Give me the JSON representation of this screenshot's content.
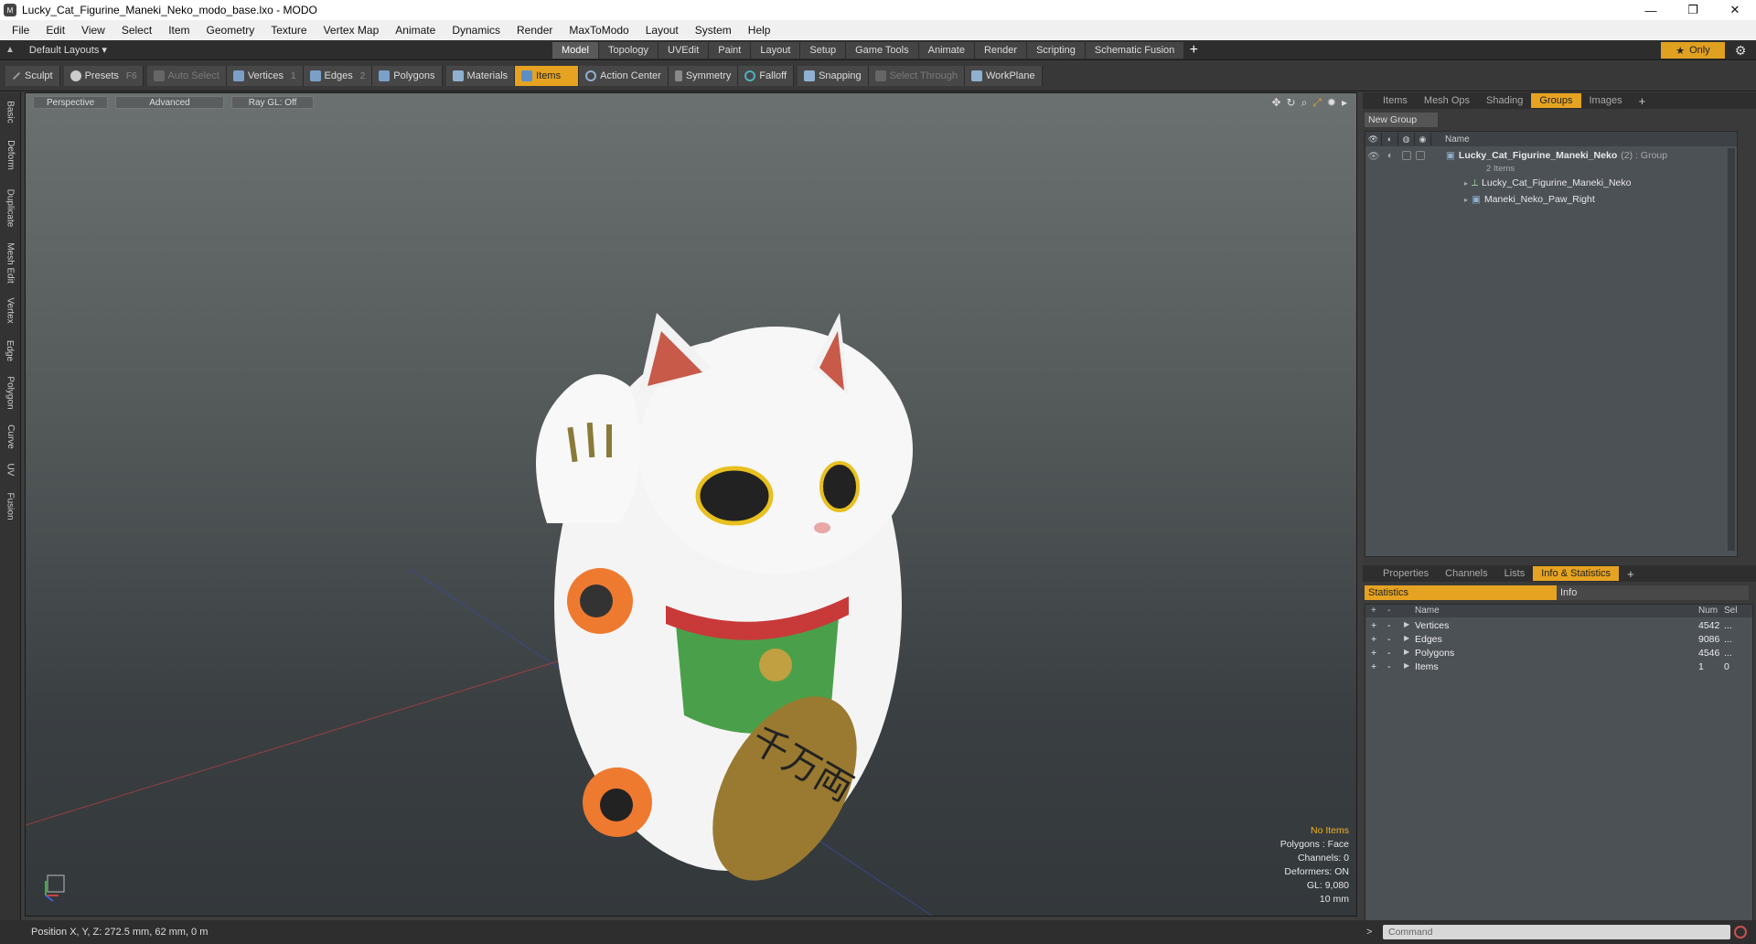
{
  "window": {
    "title": "Lucky_Cat_Figurine_Maneki_Neko_modo_base.lxo - MODO",
    "app_icon": "modo-logo",
    "buttons": {
      "minimize": "—",
      "restore": "❐",
      "close": "✕"
    }
  },
  "menu": [
    "File",
    "Edit",
    "View",
    "Select",
    "Item",
    "Geometry",
    "Texture",
    "Vertex Map",
    "Animate",
    "Dynamics",
    "Render",
    "MaxToModo",
    "Layout",
    "System",
    "Help"
  ],
  "layoutbar": {
    "layout_label": "Default Layouts",
    "tabs": [
      "Model",
      "Topology",
      "UVEdit",
      "Paint",
      "Layout",
      "Setup",
      "Game Tools",
      "Animate",
      "Render",
      "Scripting",
      "Schematic Fusion"
    ],
    "active_tab": "Model",
    "add_tab": "+",
    "only_label": "Only",
    "accent": "#e6a321"
  },
  "toolbar": {
    "sculpt": "Sculpt",
    "presets": "Presets",
    "presets_key": "F6",
    "auto_select": "Auto Select",
    "vertices": "Vertices",
    "vertices_key": "1",
    "edges": "Edges",
    "edges_key": "2",
    "polygons": "Polygons",
    "materials": "Materials",
    "items": "Items",
    "action_center": "Action Center",
    "symmetry": "Symmetry",
    "falloff": "Falloff",
    "snapping": "Snapping",
    "select_through": "Select Through",
    "workplane": "WorkPlane"
  },
  "left_tabs": [
    "Basic",
    "Deform",
    "Duplicate",
    "Mesh Edit",
    "Vertex",
    "Edge",
    "Polygon",
    "Curve",
    "UV",
    "Fusion"
  ],
  "viewport": {
    "view_mode": "Perspective",
    "shading": "Advanced",
    "raygl": "Ray GL: Off",
    "stats": {
      "selection": "No Items",
      "polygons": "Polygons : Face",
      "channels": "Channels: 0",
      "deformers": "Deformers: ON",
      "gl": "GL: 9,080",
      "unit": "10 mm"
    },
    "coin_text": "千万両"
  },
  "groups_panel": {
    "tabs": [
      "Items",
      "Mesh Ops",
      "Shading",
      "Groups",
      "Images"
    ],
    "active_tab": "Groups",
    "add_tab": "+",
    "new_group": "New Group",
    "column_name": "Name",
    "group": {
      "name": "Lucky_Cat_Figurine_Maneki_Neko",
      "count_suffix": "(2)",
      "type_suffix": ": Group",
      "sub": "2 Items",
      "children": [
        "Lucky_Cat_Figurine_Maneki_Neko",
        "Maneki_Neko_Paw_Right"
      ]
    }
  },
  "stats_panel": {
    "tabs": [
      "Properties",
      "Channels",
      "Lists",
      "Info & Statistics"
    ],
    "active_tab": "Info & Statistics",
    "add_tab": "+",
    "subtabs": [
      "Statistics",
      "Info"
    ],
    "columns": {
      "name": "Name",
      "num": "Num",
      "sel": "Sel"
    },
    "rows": [
      {
        "plus": "+",
        "minus": "-",
        "name": "Vertices",
        "num": "4542",
        "sel": "..."
      },
      {
        "plus": "+",
        "minus": "-",
        "name": "Edges",
        "num": "9086",
        "sel": "..."
      },
      {
        "plus": "+",
        "minus": "-",
        "name": "Polygons",
        "num": "4546",
        "sel": "..."
      },
      {
        "plus": "+",
        "minus": "-",
        "name": "Items",
        "num": "1",
        "sel": "0"
      }
    ]
  },
  "command": {
    "prompt": ">",
    "placeholder": "Command"
  },
  "statusbar": {
    "position": "Position X, Y, Z:   272.5 mm, 62 mm, 0 m"
  }
}
